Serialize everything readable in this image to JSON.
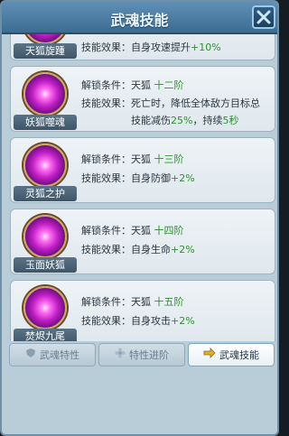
{
  "header": {
    "title": "武魂技能"
  },
  "skills": [
    {
      "name": "天狐旋踵",
      "line1_key": "技能效果：",
      "line1_val": "自身攻速提升",
      "line1_num": "+10%"
    },
    {
      "name": "妖狐噬魂",
      "unlock_key": "解锁条件：",
      "unlock_beast": "天狐",
      "unlock_stage": "十二阶",
      "effect_key": "技能效果：",
      "effect_val": "死亡时，降低全体敌方目标总",
      "effect_val2a": "技能减伤",
      "effect_num1": "25%",
      "effect_val2b": "，持续",
      "effect_num2": "5秒"
    },
    {
      "name": "灵狐之护",
      "unlock_key": "解锁条件：",
      "unlock_beast": "天狐",
      "unlock_stage": "十三阶",
      "effect_key": "技能效果：",
      "effect_val": "自身防御",
      "effect_num": "+2%"
    },
    {
      "name": "玉面妖狐",
      "unlock_key": "解锁条件：",
      "unlock_beast": "天狐",
      "unlock_stage": "十四阶",
      "effect_key": "技能效果：",
      "effect_val": "自身生命",
      "effect_num": "+2%"
    },
    {
      "name": "焚烬九尾",
      "unlock_key": "解锁条件：",
      "unlock_beast": "天狐",
      "unlock_stage": "十五阶",
      "effect_key": "技能效果：",
      "effect_val": "自身攻击",
      "effect_num": "+2%"
    }
  ],
  "tabs": [
    {
      "label": "武魂特性",
      "active": false
    },
    {
      "label": "特性进阶",
      "active": false
    },
    {
      "label": "武魂技能",
      "active": true
    }
  ],
  "colors": {
    "accent_green": "#2f8f2f",
    "header_blue": "#4a7ba3",
    "name_plate": "#4c6577"
  }
}
